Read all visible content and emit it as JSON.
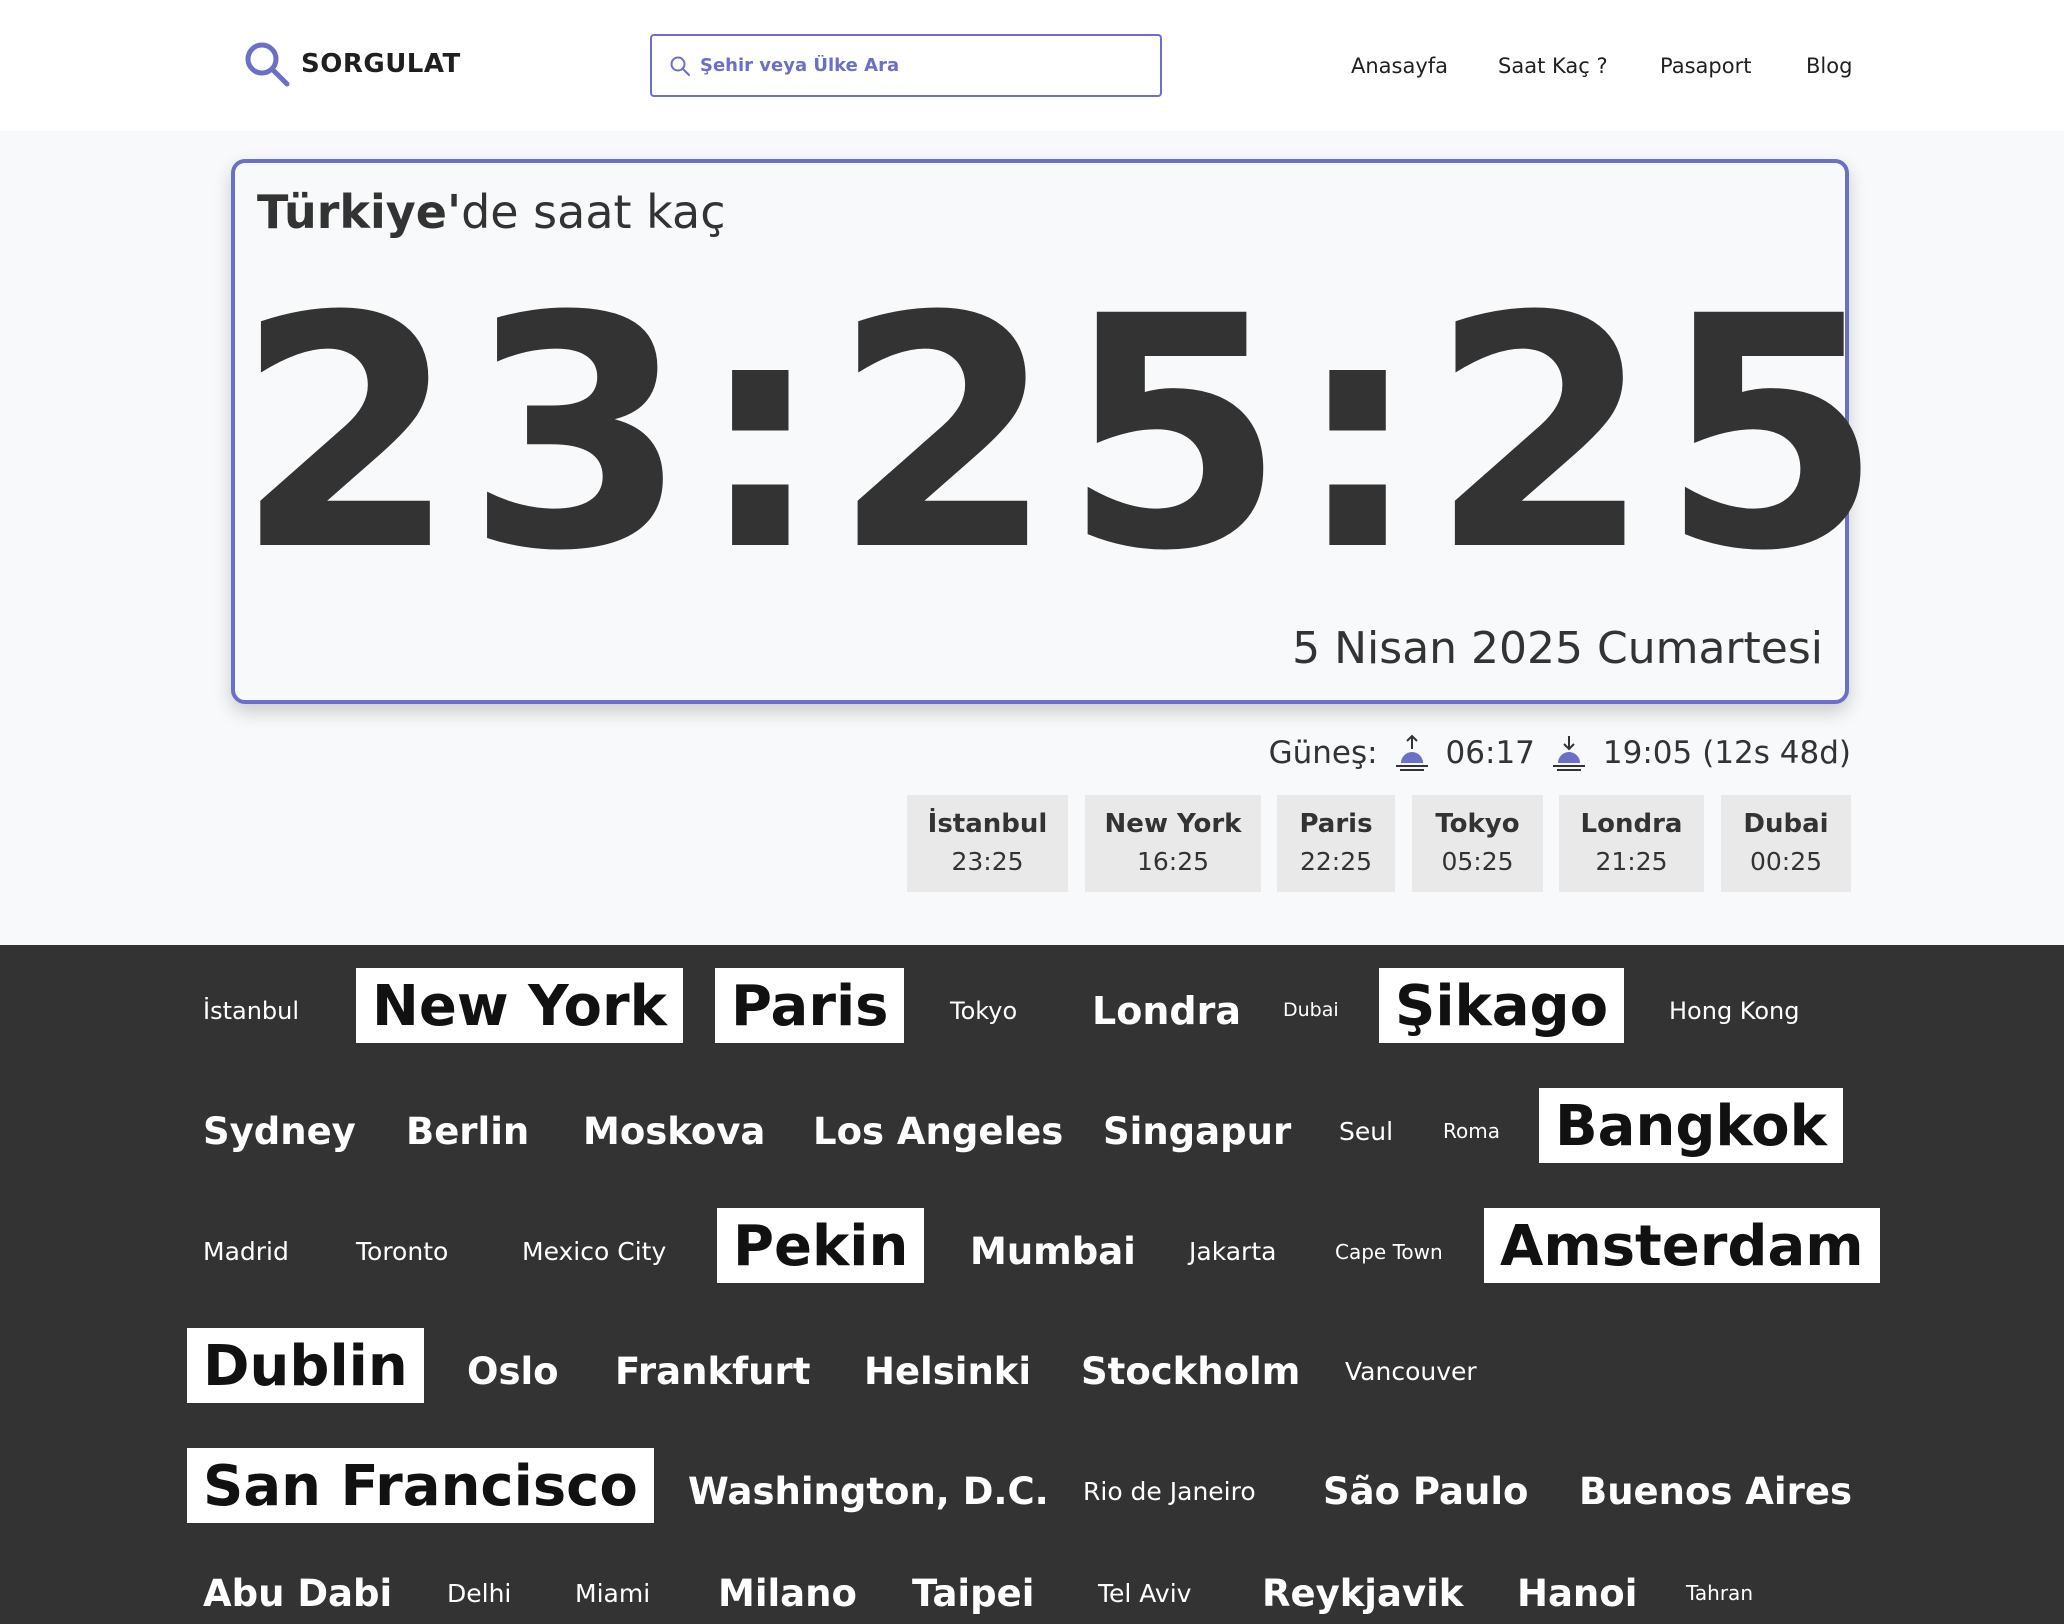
{
  "header": {
    "logo_text": "SORGULAT",
    "search_placeholder": "Şehir veya Ülke Ara",
    "nav": [
      "Anasayfa",
      "Saat Kaç ?",
      "Pasaport",
      "Blog"
    ]
  },
  "card": {
    "title_bold": "Türkiye'",
    "title_rest": "de saat kaç",
    "time": "23:25:25",
    "date": "5 Nisan 2025 Cumartesi"
  },
  "sun": {
    "label": "Güneş:",
    "sunrise": "06:17",
    "sunset": "19:05",
    "daylength": "(12s 48d)"
  },
  "cities": [
    {
      "name": "İstanbul",
      "time": "23:25"
    },
    {
      "name": "New York",
      "time": "16:25"
    },
    {
      "name": "Paris",
      "time": "22:25"
    },
    {
      "name": "Tokyo",
      "time": "05:25"
    },
    {
      "name": "Londra",
      "time": "21:25"
    },
    {
      "name": "Dubai",
      "time": "00:25"
    }
  ],
  "cloud": [
    "İstanbul",
    "New York",
    "Paris",
    "Tokyo",
    "Londra",
    "Dubai",
    "Şikago",
    "Hong Kong",
    "Sydney",
    "Berlin",
    "Moskova",
    "Los Angeles",
    "Singapur",
    "Seul",
    "Roma",
    "Bangkok",
    "Madrid",
    "Toronto",
    "Mexico City",
    "Pekin",
    "Mumbai",
    "Jakarta",
    "Cape Town",
    "Amsterdam",
    "Dublin",
    "Oslo",
    "Frankfurt",
    "Helsinki",
    "Stockholm",
    "Vancouver",
    "San Francisco",
    "Washington, D.C.",
    "Rio de Janeiro",
    "São Paulo",
    "Buenos Aires",
    "Abu Dabi",
    "Delhi",
    "Miami",
    "Milano",
    "Taipei",
    "Tel Aviv",
    "Reykjavik",
    "Hanoi",
    "Tahran"
  ],
  "colors": {
    "accent": "#6b6fc8",
    "dark": "#333333",
    "text": "#333333",
    "chip": "#e9e9e9"
  }
}
